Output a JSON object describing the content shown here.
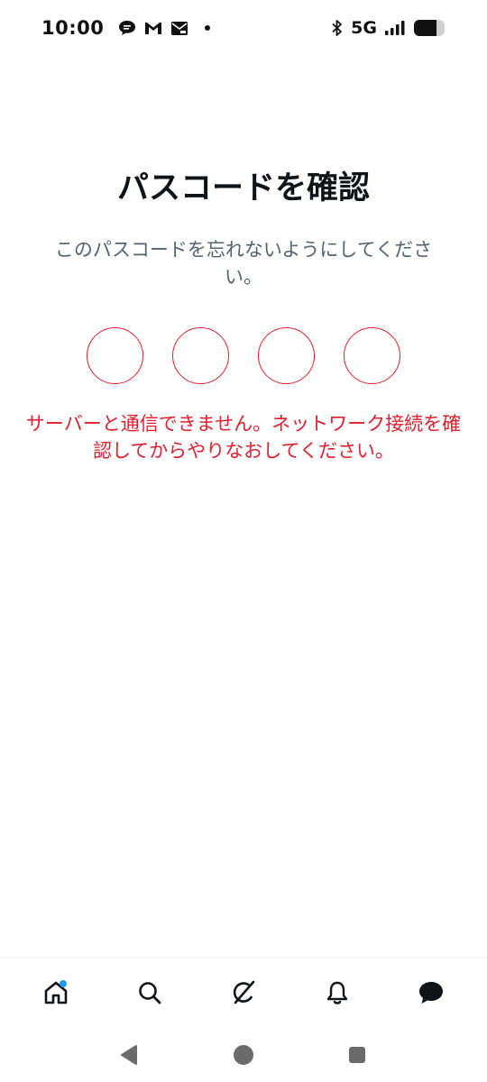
{
  "status_bar": {
    "time": "10:00",
    "network": "5G",
    "icons": [
      "chat-bubble-icon",
      "gmail-icon",
      "mail-icon",
      "bluetooth-icon",
      "signal-icon",
      "battery-icon"
    ]
  },
  "screen": {
    "title": "パスコードを確認",
    "subtitle": "このパスコードを忘れないようにしてください。",
    "pin_length": 4,
    "error_message": "サーバーと通信できません。ネットワーク接続を確認してからやりなおしてください。"
  },
  "bottom_nav": {
    "items": [
      "home-icon",
      "search-icon",
      "grok-icon",
      "notifications-icon",
      "messages-icon"
    ]
  },
  "system_nav": {
    "items": [
      "back-icon",
      "home-circle-icon",
      "recents-icon"
    ]
  },
  "colors": {
    "error": "#e0202f",
    "text_primary": "#0f1419",
    "text_secondary": "#536471",
    "accent": "#1d9bf0"
  }
}
